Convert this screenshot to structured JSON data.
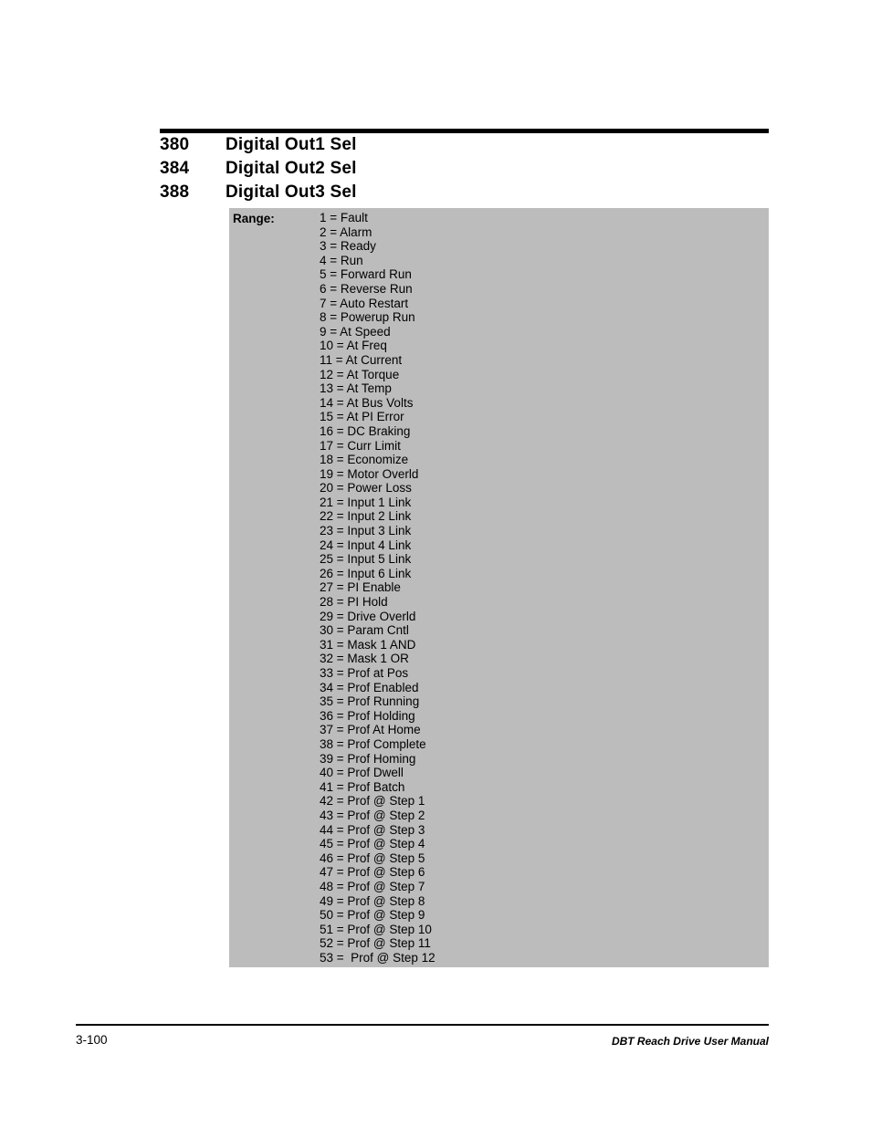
{
  "header": {
    "parameters": [
      {
        "number": "380",
        "title": "Digital Out1 Sel"
      },
      {
        "number": "384",
        "title": "Digital Out2 Sel"
      },
      {
        "number": "388",
        "title": "Digital Out3 Sel"
      }
    ]
  },
  "range": {
    "label": "Range:",
    "options": [
      "1 = Fault",
      "2 = Alarm",
      "3 = Ready",
      "4 = Run",
      "5 = Forward Run",
      "6 = Reverse Run",
      "7 = Auto Restart",
      "8 = Powerup Run",
      "9 = At Speed",
      "10 = At Freq",
      "11 = At Current",
      "12 = At Torque",
      "13 = At Temp",
      "14 = At Bus Volts",
      "15 = At PI Error",
      "16 = DC Braking",
      "17 = Curr Limit",
      "18 = Economize",
      "19 = Motor Overld",
      "20 = Power Loss",
      "21 = Input 1 Link",
      "22 = Input 2 Link",
      "23 = Input 3 Link",
      "24 = Input 4 Link",
      "25 = Input 5 Link",
      "26 = Input 6 Link",
      "27 = PI Enable",
      "28 = PI Hold",
      "29 = Drive Overld",
      "30 = Param Cntl",
      "31 = Mask 1 AND",
      "32 = Mask 1 OR",
      "33 = Prof at Pos",
      "34 = Prof Enabled",
      "35 = Prof Running",
      "36 = Prof Holding",
      "37 = Prof At Home",
      "38 = Prof Complete",
      "39 = Prof Homing",
      "40 = Prof Dwell",
      "41 = Prof Batch",
      "42 = Prof @ Step 1",
      "43 = Prof @ Step 2",
      "44 = Prof @ Step 3",
      "45 = Prof @ Step 4",
      "46 = Prof @ Step 5",
      "47 = Prof @ Step 6",
      "48 = Prof @ Step 7",
      "49 = Prof @ Step 8",
      "50 = Prof @ Step 9",
      "51 = Prof @ Step 10",
      "52 = Prof @ Step 11",
      "53 =  Prof @ Step 12"
    ]
  },
  "footer": {
    "page_number": "3-100",
    "manual_title": "DBT Reach Drive User Manual"
  },
  "colors": {
    "panel_background": "#bcbcbc",
    "text": "#000000",
    "page_background": "#ffffff"
  }
}
